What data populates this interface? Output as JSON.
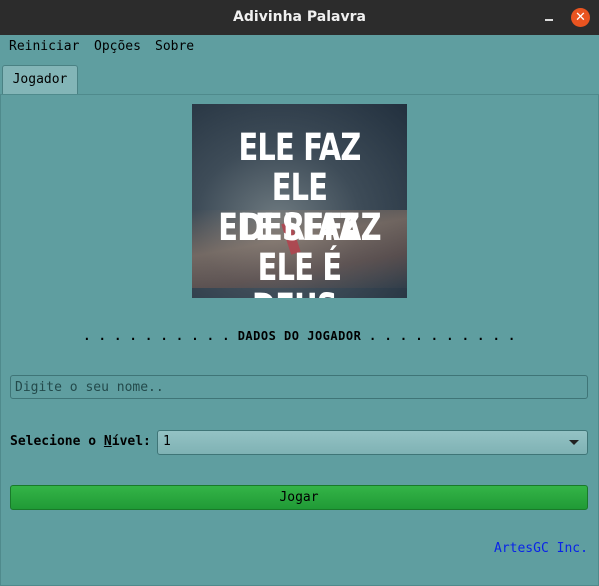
{
  "window": {
    "title": "Adivinha Palavra",
    "close_glyph": "✕"
  },
  "menu": {
    "items": [
      "Reiniciar",
      "Opções",
      "Sobre"
    ]
  },
  "tabs": [
    {
      "label": "Jogador",
      "selected": true
    }
  ],
  "banner": {
    "lines": [
      "ELE FAZ",
      "ELE DESFAZ",
      "ELE REFAZ",
      "ELE É DEUS."
    ]
  },
  "form": {
    "section_title": ". . . . . . . . . . DADOS DO JOGADOR . . . . . . . . . .",
    "name_placeholder": "Digite o seu nome..",
    "name_value": "",
    "level_label_prefix": "Selecione o ",
    "level_label_mnemonic": "N",
    "level_label_suffix": "ível:",
    "level_selected": "1",
    "play_label": "Jogar"
  },
  "footer": {
    "credits": "ArtesGC Inc."
  },
  "colors": {
    "background": "#5f9ea0",
    "titlebar": "#2c2c2c",
    "close_button": "#e95420",
    "play_button": "#2aa83e",
    "credits_text": "#0a24e8"
  }
}
